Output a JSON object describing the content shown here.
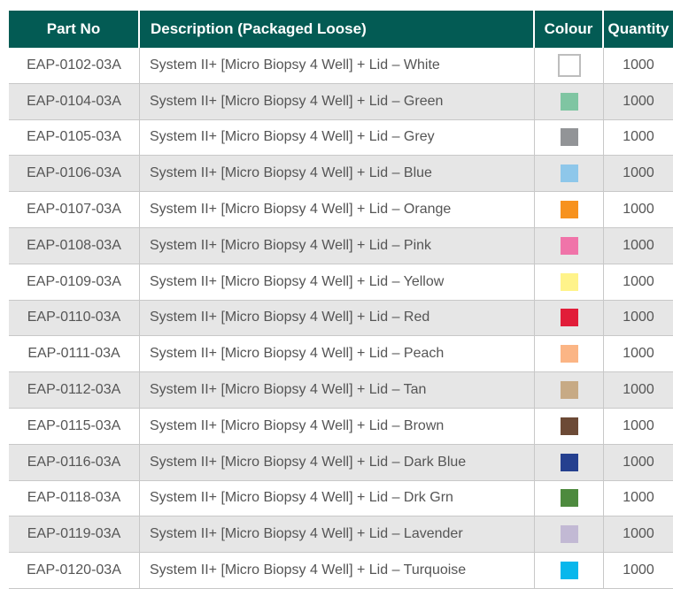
{
  "headers": {
    "part_no": "Part No",
    "description": "Description  (Packaged Loose)",
    "colour": "Colour",
    "quantity": "Quantity"
  },
  "rows": [
    {
      "part_no": "EAP-0102-03A",
      "description": "System II+ [Micro Biopsy 4 Well] + Lid – White",
      "colour": "#ffffff",
      "quantity": "1000"
    },
    {
      "part_no": "EAP-0104-03A",
      "description": "System II+ [Micro Biopsy 4 Well] + Lid – Green",
      "colour": "#7fc5a2",
      "quantity": "1000"
    },
    {
      "part_no": "EAP-0105-03A",
      "description": "System II+ [Micro Biopsy 4 Well] + Lid – Grey",
      "colour": "#929497",
      "quantity": "1000"
    },
    {
      "part_no": "EAP-0106-03A",
      "description": "System II+ [Micro Biopsy 4 Well] + Lid – Blue",
      "colour": "#8ec7ea",
      "quantity": "1000"
    },
    {
      "part_no": "EAP-0107-03A",
      "description": "System II+ [Micro Biopsy 4 Well] + Lid – Orange",
      "colour": "#f7921e",
      "quantity": "1000"
    },
    {
      "part_no": "EAP-0108-03A",
      "description": "System II+ [Micro Biopsy 4 Well] + Lid – Pink",
      "colour": "#f074a9",
      "quantity": "1000"
    },
    {
      "part_no": "EAP-0109-03A",
      "description": "System II+ [Micro Biopsy 4 Well] + Lid – Yellow",
      "colour": "#fff38a",
      "quantity": "1000"
    },
    {
      "part_no": "EAP-0110-03A",
      "description": "System II+ [Micro Biopsy 4 Well] + Lid – Red",
      "colour": "#e11d39",
      "quantity": "1000"
    },
    {
      "part_no": "EAP-0111-03A",
      "description": "System II+ [Micro Biopsy 4 Well] + Lid – Peach",
      "colour": "#fbb585",
      "quantity": "1000"
    },
    {
      "part_no": "EAP-0112-03A",
      "description": "System II+ [Micro Biopsy 4 Well] + Lid – Tan",
      "colour": "#c7aa85",
      "quantity": "1000"
    },
    {
      "part_no": "EAP-0115-03A",
      "description": "System II+ [Micro Biopsy 4 Well] + Lid – Brown",
      "colour": "#6c4a36",
      "quantity": "1000"
    },
    {
      "part_no": "EAP-0116-03A",
      "description": "System II+ [Micro Biopsy 4 Well] + Lid – Dark Blue",
      "colour": "#25408f",
      "quantity": "1000"
    },
    {
      "part_no": "EAP-0118-03A",
      "description": "System II+ [Micro Biopsy 4 Well] + Lid – Drk Grn",
      "colour": "#4d8a3e",
      "quantity": "1000"
    },
    {
      "part_no": "EAP-0119-03A",
      "description": "System II+ [Micro Biopsy 4 Well] + Lid – Lavender",
      "colour": "#c2b9d4",
      "quantity": "1000"
    },
    {
      "part_no": "EAP-0120-03A",
      "description": "System II+ [Micro Biopsy 4 Well] + Lid – Turquoise",
      "colour": "#08b7ec",
      "quantity": "1000"
    }
  ]
}
